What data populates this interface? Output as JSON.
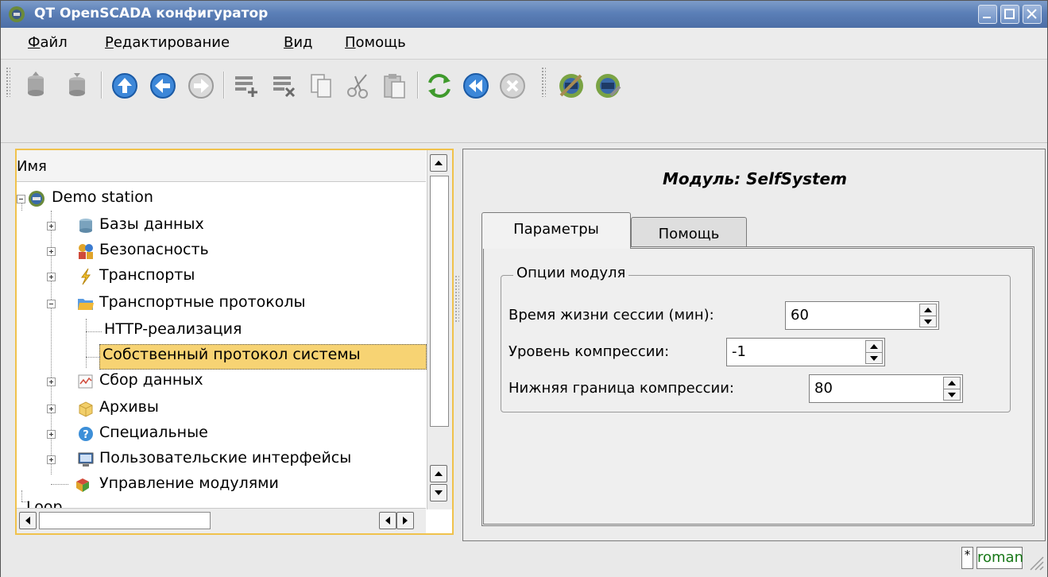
{
  "window": {
    "title": "QT OpenSCADA конфигуратор",
    "buttons": [
      "minimize",
      "maximize",
      "close"
    ]
  },
  "menu": [
    "Файл",
    "Редактирование",
    "Вид",
    "Помощь"
  ],
  "toolbar": {
    "icons": [
      "db-load-icon",
      "db-save-icon",
      "go-up-icon",
      "go-back-icon",
      "go-forward-icon",
      "add-item-icon",
      "delete-item-icon",
      "copy-icon",
      "cut-icon",
      "paste-icon",
      "refresh-icon",
      "start-icon",
      "stop-icon",
      "station-config-icon",
      "station-icon"
    ]
  },
  "tree": {
    "header": "Имя",
    "items": [
      {
        "label": "Demo station",
        "level": 0,
        "icon": "station-icon",
        "expander": "minus"
      },
      {
        "label": "Базы данных",
        "level": 1,
        "icon": "database-icon",
        "expander": "plus"
      },
      {
        "label": "Безопасность",
        "level": 1,
        "icon": "security-icon",
        "expander": "plus"
      },
      {
        "label": "Транспорты",
        "level": 1,
        "icon": "transport-icon",
        "expander": "plus"
      },
      {
        "label": "Транспортные протоколы",
        "level": 1,
        "icon": "folder-icon",
        "expander": "minus"
      },
      {
        "label": "HTTP-реализация",
        "level": 2,
        "icon": "",
        "expander": ""
      },
      {
        "label": "Собственный протокол системы",
        "level": 2,
        "icon": "",
        "expander": "",
        "selected": true
      },
      {
        "label": "Сбор данных",
        "level": 1,
        "icon": "data-acquisition-icon",
        "expander": "plus"
      },
      {
        "label": "Архивы",
        "level": 1,
        "icon": "archive-icon",
        "expander": "plus"
      },
      {
        "label": "Специальные",
        "level": 1,
        "icon": "help-icon",
        "expander": "plus"
      },
      {
        "label": "Пользовательские интерфейсы",
        "level": 1,
        "icon": "monitor-icon",
        "expander": "plus"
      },
      {
        "label": "Управление модулями",
        "level": 1,
        "icon": "modules-icon",
        "expander": ""
      },
      {
        "label": "Loop",
        "level": 0,
        "icon": "",
        "expander": ""
      }
    ]
  },
  "module": {
    "title": "Модуль: SelfSystem",
    "tabs": [
      "Параметры",
      "Помощь"
    ],
    "active_tab": "Параметры",
    "group_title": "Опции модуля",
    "fields": [
      {
        "label": "Время жизни сессии (мин):",
        "value": "60"
      },
      {
        "label": "Уровень компрессии:",
        "value": "-1"
      },
      {
        "label": "Нижняя граница компрессии:",
        "value": "80"
      }
    ]
  },
  "status": {
    "modified": "*",
    "user": "roman"
  },
  "colors": {
    "titlebar": "#5b7fb7",
    "selection": "#f7d373",
    "focus_border": "#f0c24c",
    "user": "#187818"
  }
}
